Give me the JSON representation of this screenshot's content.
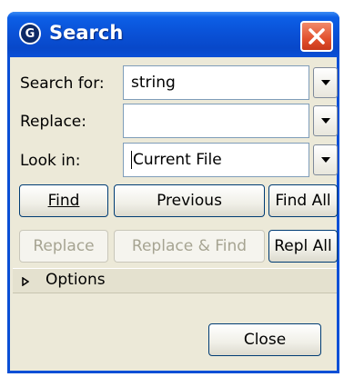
{
  "window": {
    "title": "Search",
    "app_icon_letter": "G"
  },
  "labels": {
    "search_for": "Search for:",
    "replace": "Replace:",
    "look_in": "Look in:"
  },
  "fields": {
    "search_for_value": "string",
    "replace_value": "",
    "look_in_value": "Current File"
  },
  "buttons": {
    "find": "Find",
    "previous": "Previous",
    "find_all": "Find All",
    "replace": "Replace",
    "replace_and_find": "Replace & Find",
    "replace_all": "Repl All",
    "close": "Close"
  },
  "options": {
    "label": "Options"
  },
  "colors": {
    "titlebar": "#0a52d8",
    "window_bg": "#ece9d8",
    "close_button": "#e2502d",
    "button_border": "#003c74",
    "disabled_text": "#a6a492"
  }
}
